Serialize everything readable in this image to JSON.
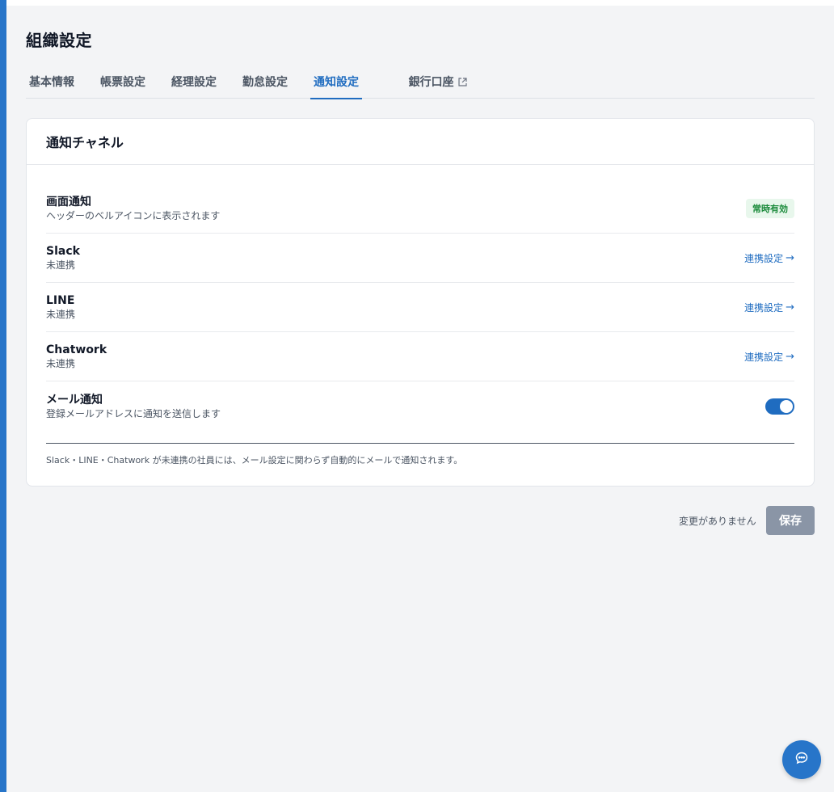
{
  "page": {
    "title": "組織設定"
  },
  "tabs": [
    {
      "label": "基本情報"
    },
    {
      "label": "帳票設定"
    },
    {
      "label": "経理設定"
    },
    {
      "label": "勤怠設定"
    },
    {
      "label": "通知設定",
      "active": true
    },
    {
      "label": "銀行口座",
      "external": true
    }
  ],
  "card": {
    "title": "通知チャネル",
    "rows": [
      {
        "title": "画面通知",
        "subtitle": "ヘッダーのベルアイコンに表示されます",
        "badge": "常時有効"
      },
      {
        "title": "Slack",
        "subtitle": "未連携",
        "action": "連携設定",
        "action_arrow": "→"
      },
      {
        "title": "LINE",
        "subtitle": "未連携",
        "action": "連携設定",
        "action_arrow": "→"
      },
      {
        "title": "Chatwork",
        "subtitle": "未連携",
        "action": "連携設定",
        "action_arrow": "→"
      },
      {
        "title": "メール通知",
        "subtitle": "登録メールアドレスに通知を送信します",
        "toggle_on": true
      }
    ],
    "note": "Slack・LINE・Chatwork が未連携の社員には、メール設定に関わらず自動的にメールで通知されます。"
  },
  "footer": {
    "status": "変更がありません",
    "save_label": "保存"
  },
  "colors": {
    "accent": "#1f6cc0",
    "sidebar_stripe": "#2775c9",
    "badge_bg": "#e8f7ec",
    "badge_text": "#1a8a3a",
    "save_disabled": "#8a95a6"
  },
  "icons": {
    "external": "external-link-icon",
    "chat": "chat-bubble-icon"
  }
}
